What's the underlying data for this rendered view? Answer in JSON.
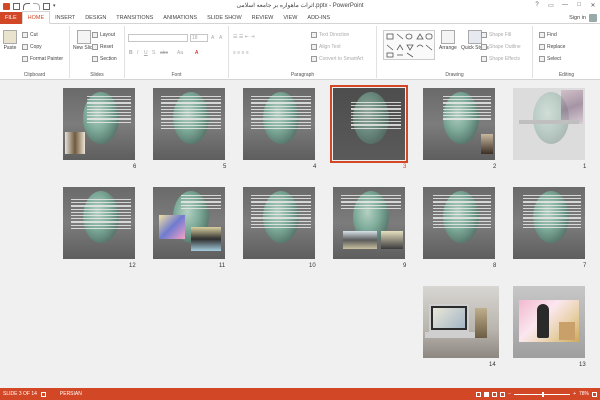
{
  "app": {
    "title": "اثرات ماهواره بر جامعه اسلامی.pptx - PowerPoint"
  },
  "window_controls": {
    "help": "?",
    "restore": "▭",
    "minimize": "—",
    "maximize": "□",
    "close": "✕"
  },
  "tabs": [
    "FILE",
    "HOME",
    "INSERT",
    "DESIGN",
    "TRANSITIONS",
    "ANIMATIONS",
    "SLIDE SHOW",
    "REVIEW",
    "VIEW",
    "ADD-INS"
  ],
  "account": {
    "signin": "Sign in"
  },
  "ribbon": {
    "clipboard": {
      "label": "Clipboard",
      "paste": "Paste",
      "cut": "Cut",
      "copy": "Copy",
      "format_painter": "Format Painter"
    },
    "slides": {
      "label": "Slides",
      "new_slide": "New Slide",
      "layout": "Layout",
      "reset": "Reset",
      "section": "Section"
    },
    "font": {
      "label": "Font",
      "size": "18",
      "bold": "B",
      "italic": "I",
      "underline": "U",
      "strike": "S",
      "shadow": "abc",
      "aa": "Aa"
    },
    "paragraph": {
      "label": "Paragraph",
      "text_direction": "Text Direction",
      "align_text": "Align Text",
      "convert": "Convert to SmartArt"
    },
    "drawing": {
      "label": "Drawing",
      "arrange": "Arrange",
      "quick_styles": "Quick Styles",
      "shape_fill": "Shape Fill",
      "shape_outline": "Shape Outline",
      "shape_effects": "Shape Effects"
    },
    "editing": {
      "label": "Editing",
      "find": "Find",
      "replace": "Replace",
      "select": "Select"
    }
  },
  "slides": [
    {
      "num": "1",
      "selected": false
    },
    {
      "num": "2",
      "selected": false
    },
    {
      "num": "3",
      "selected": true
    },
    {
      "num": "4",
      "selected": false
    },
    {
      "num": "5",
      "selected": false
    },
    {
      "num": "6",
      "selected": false
    },
    {
      "num": "7",
      "selected": false
    },
    {
      "num": "8",
      "selected": false
    },
    {
      "num": "9",
      "selected": false
    },
    {
      "num": "10",
      "selected": false
    },
    {
      "num": "11",
      "selected": false
    },
    {
      "num": "12",
      "selected": false
    },
    {
      "num": "13",
      "selected": false
    },
    {
      "num": "14",
      "selected": false
    }
  ],
  "status": {
    "slide": "SLIDE 3 OF 14",
    "language": "PERSIAN",
    "zoom": "78%"
  },
  "colors": {
    "accent": "#d24726"
  }
}
